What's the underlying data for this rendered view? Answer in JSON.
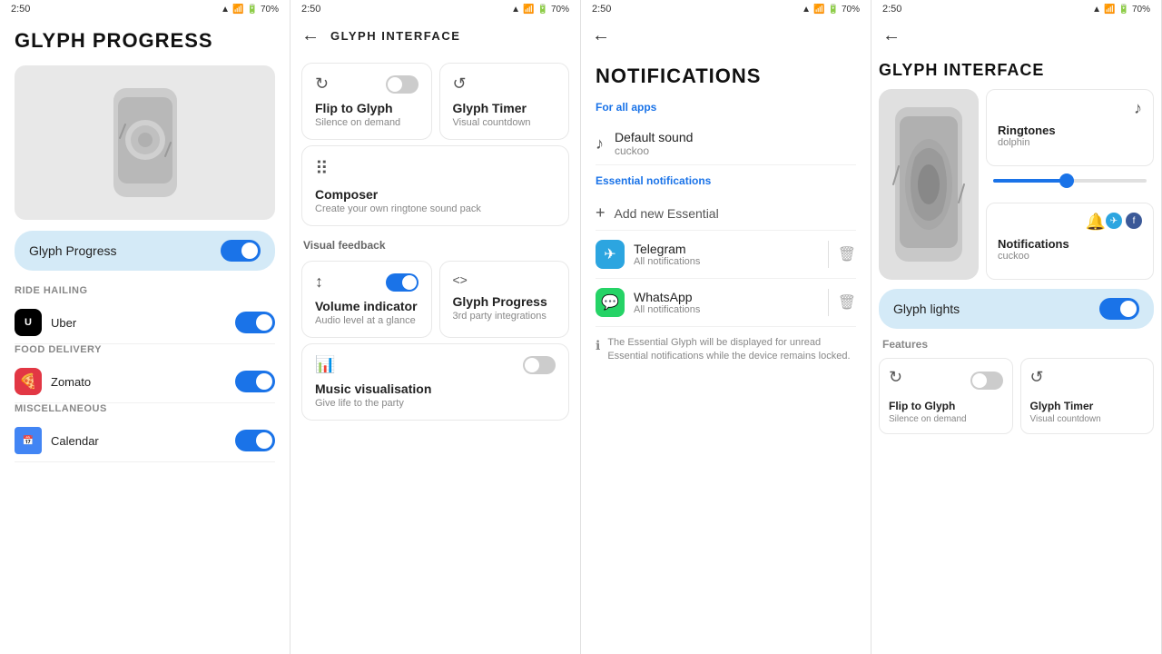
{
  "panels": [
    {
      "id": "panel1",
      "statusbar": {
        "time": "2:50",
        "battery": "70%"
      },
      "title": "GLYPH PROGRESS",
      "glyphProgress": {
        "label": "Glyph Progress",
        "enabled": true
      },
      "sections": [
        {
          "label": "Ride hailing",
          "apps": [
            {
              "name": "Uber",
              "icon": "uber",
              "enabled": true
            }
          ]
        },
        {
          "label": "Food delivery",
          "apps": [
            {
              "name": "Zomato",
              "icon": "zomato",
              "enabled": true
            }
          ]
        },
        {
          "label": "Miscellaneous",
          "apps": [
            {
              "name": "Calendar",
              "icon": "calendar",
              "enabled": true
            }
          ]
        }
      ]
    },
    {
      "id": "panel2",
      "statusbar": {
        "time": "2:50",
        "battery": "70%"
      },
      "navTitle": "GLYPH INTERFACE",
      "features": [
        {
          "icon": "↻",
          "title": "Flip to Glyph",
          "desc": "Silence on demand",
          "hasToggle": true,
          "toggleOn": false,
          "secondIcon": "↺",
          "secondTitle": "Glyph Timer",
          "secondDesc": "Visual countdown"
        }
      ],
      "composer": {
        "icon": "⠿",
        "title": "Composer",
        "desc": "Create your own ringtone sound pack"
      },
      "visualFeedback": {
        "label": "Visual feedback",
        "items": [
          {
            "icon": "↕",
            "title": "Volume indicator",
            "desc": "Audio level at a glance",
            "hasToggle": true,
            "toggleOn": true
          },
          {
            "icon": "<>",
            "title": "Glyph Progress",
            "desc": "3rd party integrations",
            "hasToggle": false
          }
        ]
      },
      "musicVis": {
        "icon": "📊",
        "title": "Music visualisation",
        "desc": "Give life to the party",
        "hasToggle": true,
        "toggleOn": false
      }
    },
    {
      "id": "panel3",
      "statusbar": {
        "time": "2:50",
        "battery": "70%"
      },
      "title": "NOTIFICATIONS",
      "forAllApps": "For all apps",
      "defaultSound": {
        "label": "Default sound",
        "value": "cuckoo"
      },
      "essentialLabel": "Essential notifications",
      "addEssential": "Add new Essential",
      "apps": [
        {
          "name": "Telegram",
          "type": "telegram",
          "notifLabel": "All notifications"
        },
        {
          "name": "WhatsApp",
          "type": "whatsapp",
          "notifLabel": "All notifications"
        }
      ],
      "infoText": "The Essential Glyph will be displayed for unread Essential notifications while the device remains locked."
    },
    {
      "id": "panel4",
      "statusbar": {
        "time": "2:50",
        "battery": "70%"
      },
      "title": "GLYPH INTERFACE",
      "ringtones": {
        "label": "Ringtones",
        "value": "dolphin"
      },
      "notifications": {
        "label": "Notifications",
        "value": "cuckoo"
      },
      "glyphLights": {
        "label": "Glyph lights",
        "enabled": true
      },
      "featuresLabel": "Features",
      "features": [
        {
          "title": "Flip to Glyph",
          "sub": "Silence on demand",
          "icon": "↻",
          "hasToggle": true,
          "toggleOn": false
        },
        {
          "title": "Glyph Timer",
          "sub": "Visual countdown",
          "icon": "↺",
          "hasToggle": false
        }
      ]
    }
  ]
}
